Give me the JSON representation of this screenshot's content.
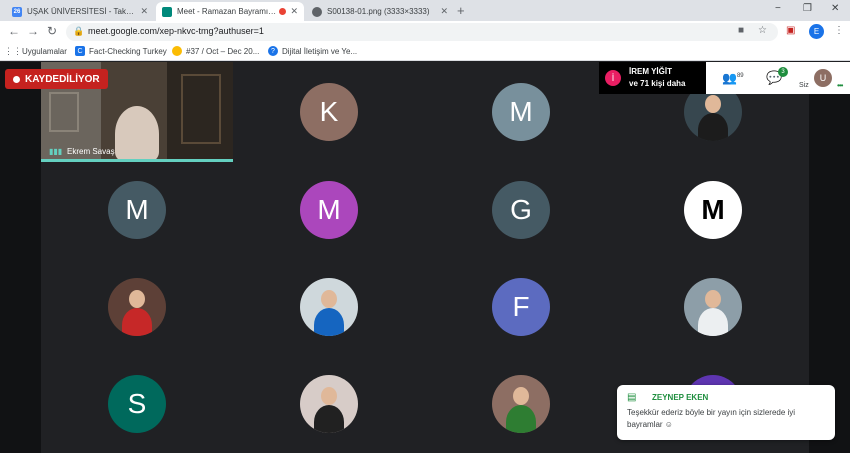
{
  "browser": {
    "tabs": [
      {
        "favicon_text": "26",
        "favicon_color": "#4285f4",
        "title": "UŞAK ÜNİVERSİTESİ - Takvim - Sa",
        "active": false
      },
      {
        "favicon_text": "",
        "favicon_color": "#00897b",
        "title": "Meet - Ramazan Bayramı Ba",
        "active": true,
        "recording": true
      },
      {
        "favicon_text": "",
        "favicon_color": "#5f6368",
        "title": "S00138-01.png (3333×3333)",
        "active": false
      }
    ],
    "new_tab": "+",
    "window_controls": [
      "−",
      "❐",
      "✕"
    ],
    "nav": {
      "back": "←",
      "forward": "→",
      "reload": "↻"
    },
    "url": "meet.google.com/xep-nkvc-tmg?authuser=1",
    "profile_initial": "E",
    "bookmarks": [
      {
        "label": "Uygulamalar",
        "icon": "apps-grid-icon",
        "color": "#5f6368"
      },
      {
        "label": "Fact-Checking Turkey",
        "icon": "bookmark-icon",
        "color": "#1a73e8"
      },
      {
        "label": "#37 / Oct – Dec 20...",
        "icon": "chrome-icon",
        "color": "#fbbc04"
      },
      {
        "label": "Dijital İletişim ve Ye...",
        "icon": "help-icon",
        "color": "#1a73e8"
      }
    ]
  },
  "meet": {
    "recording_label": "KAYDEDİLİYOR",
    "speaker_name": "Ekrem Savaş",
    "presenter": {
      "initial": "İ",
      "line1": "İREM YİĞİT",
      "line2": "ve 71 kişi daha"
    },
    "people_count": "89",
    "chat_count": "3",
    "self_label": "Siz",
    "self_initial": "U",
    "tiles": [
      {
        "letter": "K",
        "color": "#8d6e63"
      },
      {
        "letter": "M",
        "color": "#78909c"
      },
      {
        "letter": "",
        "photo": true,
        "color": "#37474f",
        "body": "#1c1c1c"
      },
      {
        "letter": "M",
        "color": "#455a64"
      },
      {
        "letter": "M",
        "color": "#ab47bc"
      },
      {
        "letter": "G",
        "color": "#455a64"
      },
      {
        "letter": "M",
        "color": "#ffffff",
        "text_color": "#000000"
      },
      {
        "letter": "",
        "photo": true,
        "color": "#5d4037",
        "body": "#c62828"
      },
      {
        "letter": "",
        "photo": true,
        "color": "#cfd8dc",
        "body": "#1565c0"
      },
      {
        "letter": "F",
        "color": "#5c6bc0"
      },
      {
        "letter": "",
        "photo": true,
        "color": "#8d9ea8",
        "body": "#eceff1"
      },
      {
        "letter": "S",
        "color": "#00695c"
      },
      {
        "letter": "",
        "photo": true,
        "color": "#d7ccc8",
        "body": "#212121"
      },
      {
        "letter": "",
        "photo": true,
        "color": "#8d6e63",
        "body": "#2e7d32"
      },
      {
        "letter": "",
        "photo": false,
        "color": "#5e35b1"
      }
    ],
    "chat_toast": {
      "sender": "ZEYNEP EKEN",
      "message": "Teşekkür ederiz böyle bir yayın için sizlerede iyi bayramlar ☺"
    }
  }
}
